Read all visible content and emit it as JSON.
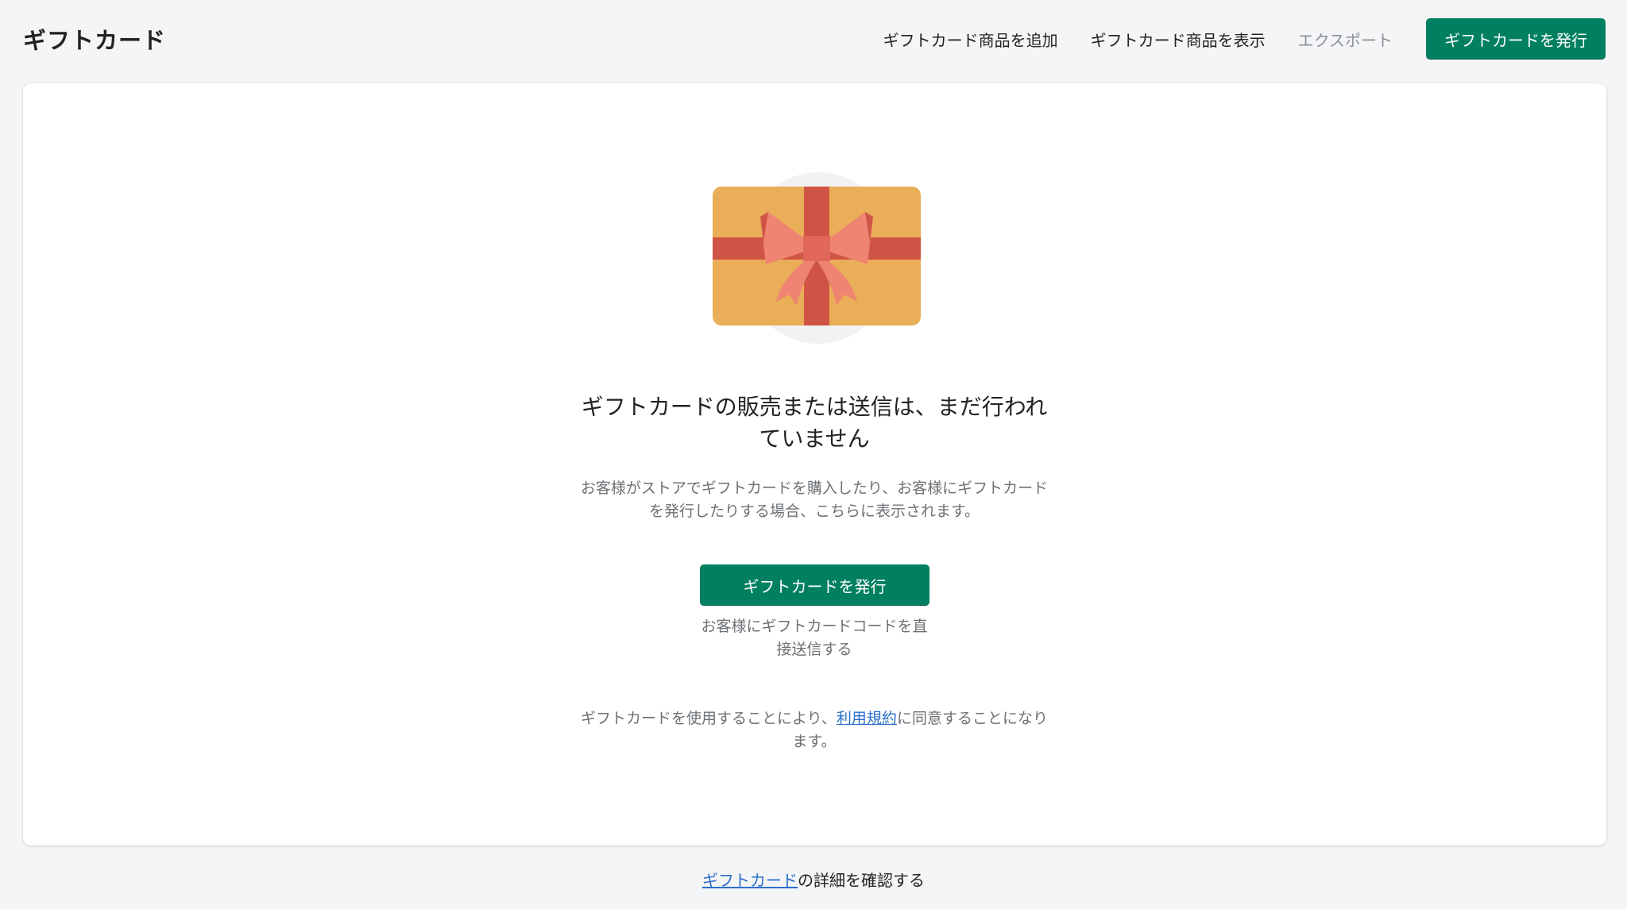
{
  "header": {
    "title": "ギフトカード",
    "actions": {
      "add_product": "ギフトカード商品を追加",
      "view_products": "ギフトカード商品を表示",
      "export": "エクスポート",
      "issue": "ギフトカードを発行"
    }
  },
  "empty_state": {
    "illustration_icon": "gift-card-icon",
    "title": "ギフトカードの販売または送信は、まだ行われていません",
    "description": "お客様がストアでギフトカードを購入したり、お客様にギフトカードを発行したりする場合、こちらに表示されます。",
    "primary_button": "ギフトカードを発行",
    "button_help": "お客様にギフトカードコードを直接送信する",
    "terms": {
      "before": "ギフトカードを使用することにより、",
      "link": "利用規約",
      "after": "に同意することになります。"
    }
  },
  "footer": {
    "link": "ギフトカード",
    "text": "の詳細を確認する"
  },
  "colors": {
    "primary": "#008060",
    "link": "#2c6ecb",
    "background": "#f4f5f7",
    "card_gold": "#e9ae57",
    "ribbon": "#d05446",
    "bow": "#ef8472"
  }
}
